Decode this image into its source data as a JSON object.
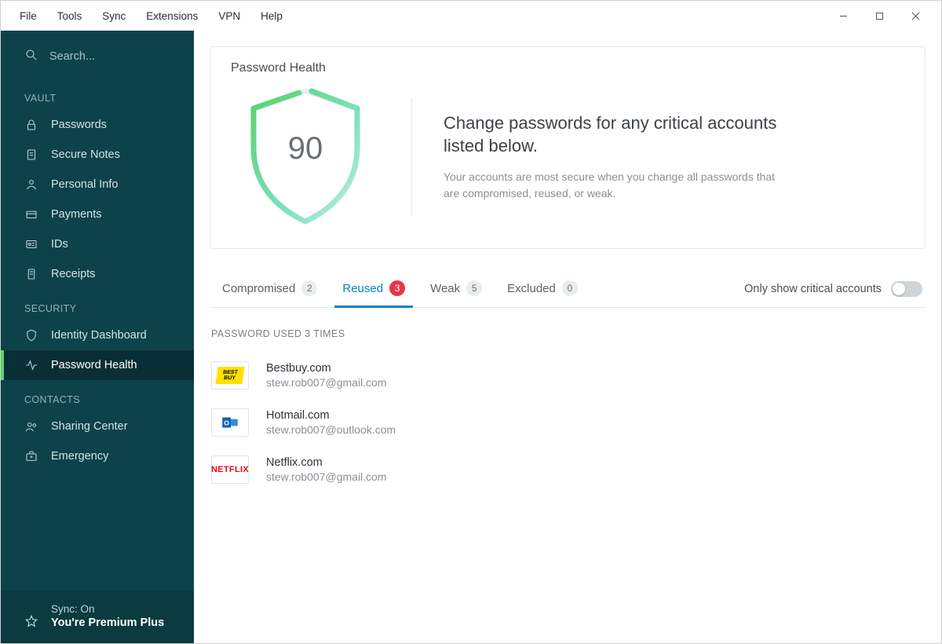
{
  "menubar": {
    "items": [
      "File",
      "Tools",
      "Sync",
      "Extensions",
      "VPN",
      "Help"
    ]
  },
  "search": {
    "placeholder": "Search..."
  },
  "sidebar": {
    "sections": {
      "vault": {
        "label": "VAULT",
        "items": [
          {
            "label": "Passwords"
          },
          {
            "label": "Secure Notes"
          },
          {
            "label": "Personal Info"
          },
          {
            "label": "Payments"
          },
          {
            "label": "IDs"
          },
          {
            "label": "Receipts"
          }
        ]
      },
      "security": {
        "label": "SECURITY",
        "items": [
          {
            "label": "Identity Dashboard"
          },
          {
            "label": "Password Health"
          }
        ]
      },
      "contacts": {
        "label": "CONTACTS",
        "items": [
          {
            "label": "Sharing Center"
          },
          {
            "label": "Emergency"
          }
        ]
      }
    },
    "footer": {
      "sync": "Sync: On",
      "plan": "You're Premium Plus"
    }
  },
  "card": {
    "title": "Password Health",
    "score": "90",
    "headline": "Change passwords for any critical accounts listed below.",
    "sub": "Your accounts are most secure when you change all passwords that are compromised, reused, or weak."
  },
  "tabs": {
    "compromised": {
      "label": "Compromised",
      "count": "2"
    },
    "reused": {
      "label": "Reused",
      "count": "3"
    },
    "weak": {
      "label": "Weak",
      "count": "5"
    },
    "excluded": {
      "label": "Excluded",
      "count": "0"
    }
  },
  "toggle": {
    "label": "Only show critical accounts"
  },
  "group": {
    "header": "PASSWORD USED 3 TIMES"
  },
  "accounts": [
    {
      "site": "Bestbuy.com",
      "user": "stew.rob007@gmail.com"
    },
    {
      "site": "Hotmail.com",
      "user": "stew.rob007@outlook.com"
    },
    {
      "site": "Netflix.com",
      "user": "stew.rob007@gmail.com"
    }
  ],
  "colors": {
    "sidebar": "#0e424a",
    "accent": "#0a84c1",
    "good": "#58d66b",
    "badge_red": "#e53747"
  }
}
